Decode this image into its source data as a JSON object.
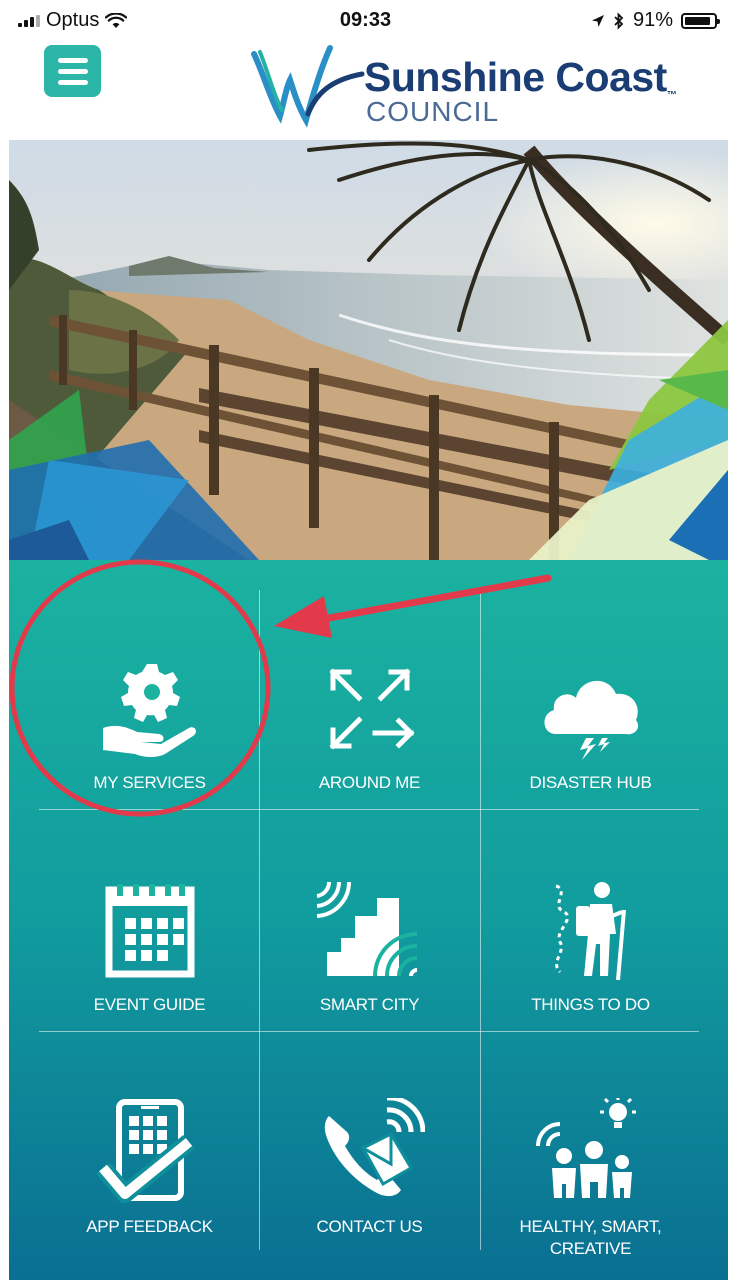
{
  "status_bar": {
    "carrier": "Optus",
    "time": "09:33",
    "battery": "91%",
    "battery_level": 0.91
  },
  "header": {
    "logo_name": "Sunshine Coast",
    "logo_sub": "COUNCIL"
  },
  "tiles": [
    {
      "label": "MY SERVICES",
      "icon": "hand-gear-icon"
    },
    {
      "label": "AROUND ME",
      "icon": "arrows-expand-icon"
    },
    {
      "label": "DISASTER HUB",
      "icon": "storm-cloud-icon"
    },
    {
      "label": "EVENT GUIDE",
      "icon": "calendar-icon"
    },
    {
      "label": "SMART CITY",
      "icon": "smart-city-icon"
    },
    {
      "label": "THINGS TO DO",
      "icon": "hiker-icon"
    },
    {
      "label": "APP FEEDBACK",
      "icon": "feedback-tablet-icon"
    },
    {
      "label": "CONTACT US",
      "icon": "phone-mail-icon"
    },
    {
      "label": "HEALTHY, SMART, CREATIVE",
      "icon": "family-idea-icon"
    }
  ],
  "colors": {
    "accent": "#2bb6a8",
    "brand_navy": "#1a3d73",
    "grid_top": "#1bb2a0",
    "grid_bottom": "#0a6f92",
    "annotation_red": "#e23a4a"
  }
}
